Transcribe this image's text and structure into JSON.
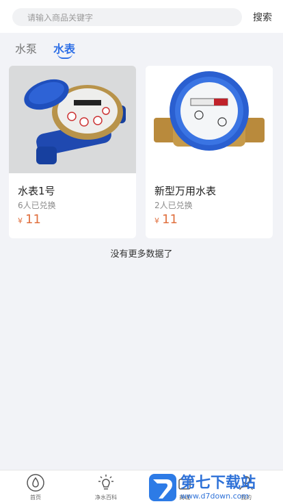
{
  "header": {
    "search_placeholder": "请输入商品关键字",
    "search_button": "搜索"
  },
  "tabs": [
    {
      "label": "水泵",
      "active": false
    },
    {
      "label": "水表",
      "active": true
    }
  ],
  "products": [
    {
      "title": "水表1号",
      "redeemed": "6人已兑换",
      "currency": "¥",
      "price": "11"
    },
    {
      "title": "新型万用水表",
      "redeemed": "2人已兑换",
      "currency": "¥",
      "price": "11"
    }
  ],
  "list_end_text": "没有更多数据了",
  "tabbar": {
    "items": [
      {
        "label": "首页",
        "icon": "water-drop-icon"
      },
      {
        "label": "净水百科",
        "icon": "lightbulb-icon"
      },
      {
        "label": "商城",
        "icon": "shop-icon"
      },
      {
        "label": "我的",
        "icon": "user-icon"
      }
    ]
  },
  "watermark": {
    "title": "第七下载站",
    "url": "www.d7down.com"
  },
  "colors": {
    "accent": "#2e6fe6",
    "price": "#e0703f",
    "background": "#f2f3f7"
  }
}
